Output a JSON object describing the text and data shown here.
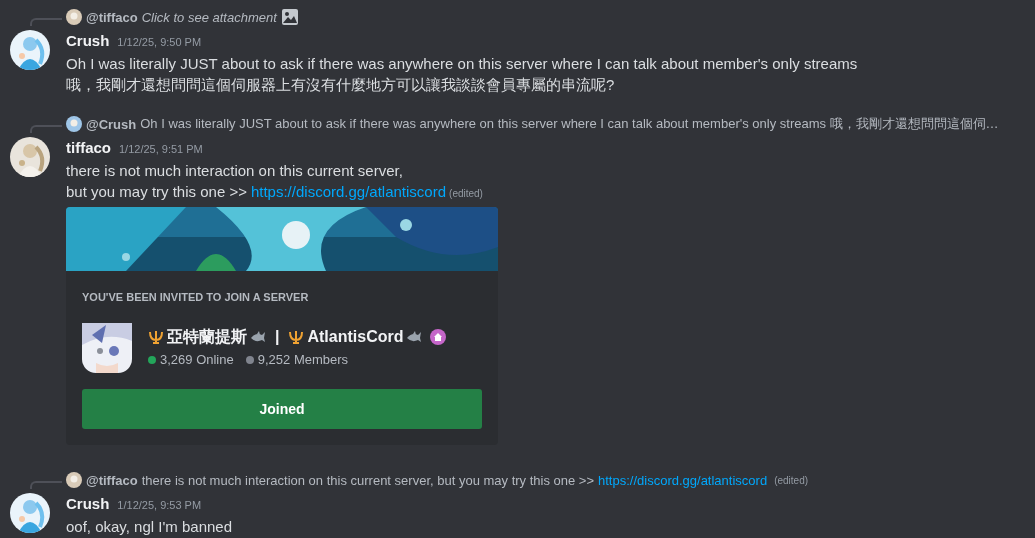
{
  "messages": [
    {
      "reply": {
        "author": "@tiffaco",
        "text": "Click to see attachment",
        "italic": true,
        "attachment": true
      },
      "author": "Crush",
      "time": "1/12/25, 9:50 PM",
      "lines": [
        "Oh I was literally JUST about to ask if there was anywhere on this server where I can talk about member's only streams",
        "哦，我剛才還想問問這個伺服器上有沒有什麼地方可以讓我談談會員專屬的串流呢?"
      ]
    },
    {
      "reply": {
        "author": "@Crush",
        "text": "Oh I was literally JUST about to ask if there was anywhere on this server where I can talk about member's only streams 哦，我剛才還想問問這個伺…",
        "italic": false,
        "attachment": false
      },
      "author": "tiffaco",
      "time": "1/12/25, 9:51 PM",
      "lines": [
        "there is not much interaction on this current server,",
        "but you may try this one >>"
      ],
      "link": "https://discord.gg/atlantiscord",
      "edited": "(edited)",
      "embed": {
        "heading": "YOU'VE BEEN INVITED TO JOIN A SERVER",
        "name_cn": "亞特蘭提斯",
        "separator": "|",
        "name_en": "AtlantisCord",
        "online": "3,269 Online",
        "members": "9,252 Members",
        "button": "Joined"
      }
    },
    {
      "reply": {
        "author": "@tiffaco",
        "text": "there is not much interaction on this current server,  but you may try this one >>",
        "italic": false,
        "attachment": false,
        "link": "https://discord.gg/atlantiscord",
        "edited": "(edited)"
      },
      "author": "Crush",
      "time": "1/12/25, 9:53 PM",
      "lines": [
        "oof, okay, ngl I'm banned"
      ]
    }
  ]
}
